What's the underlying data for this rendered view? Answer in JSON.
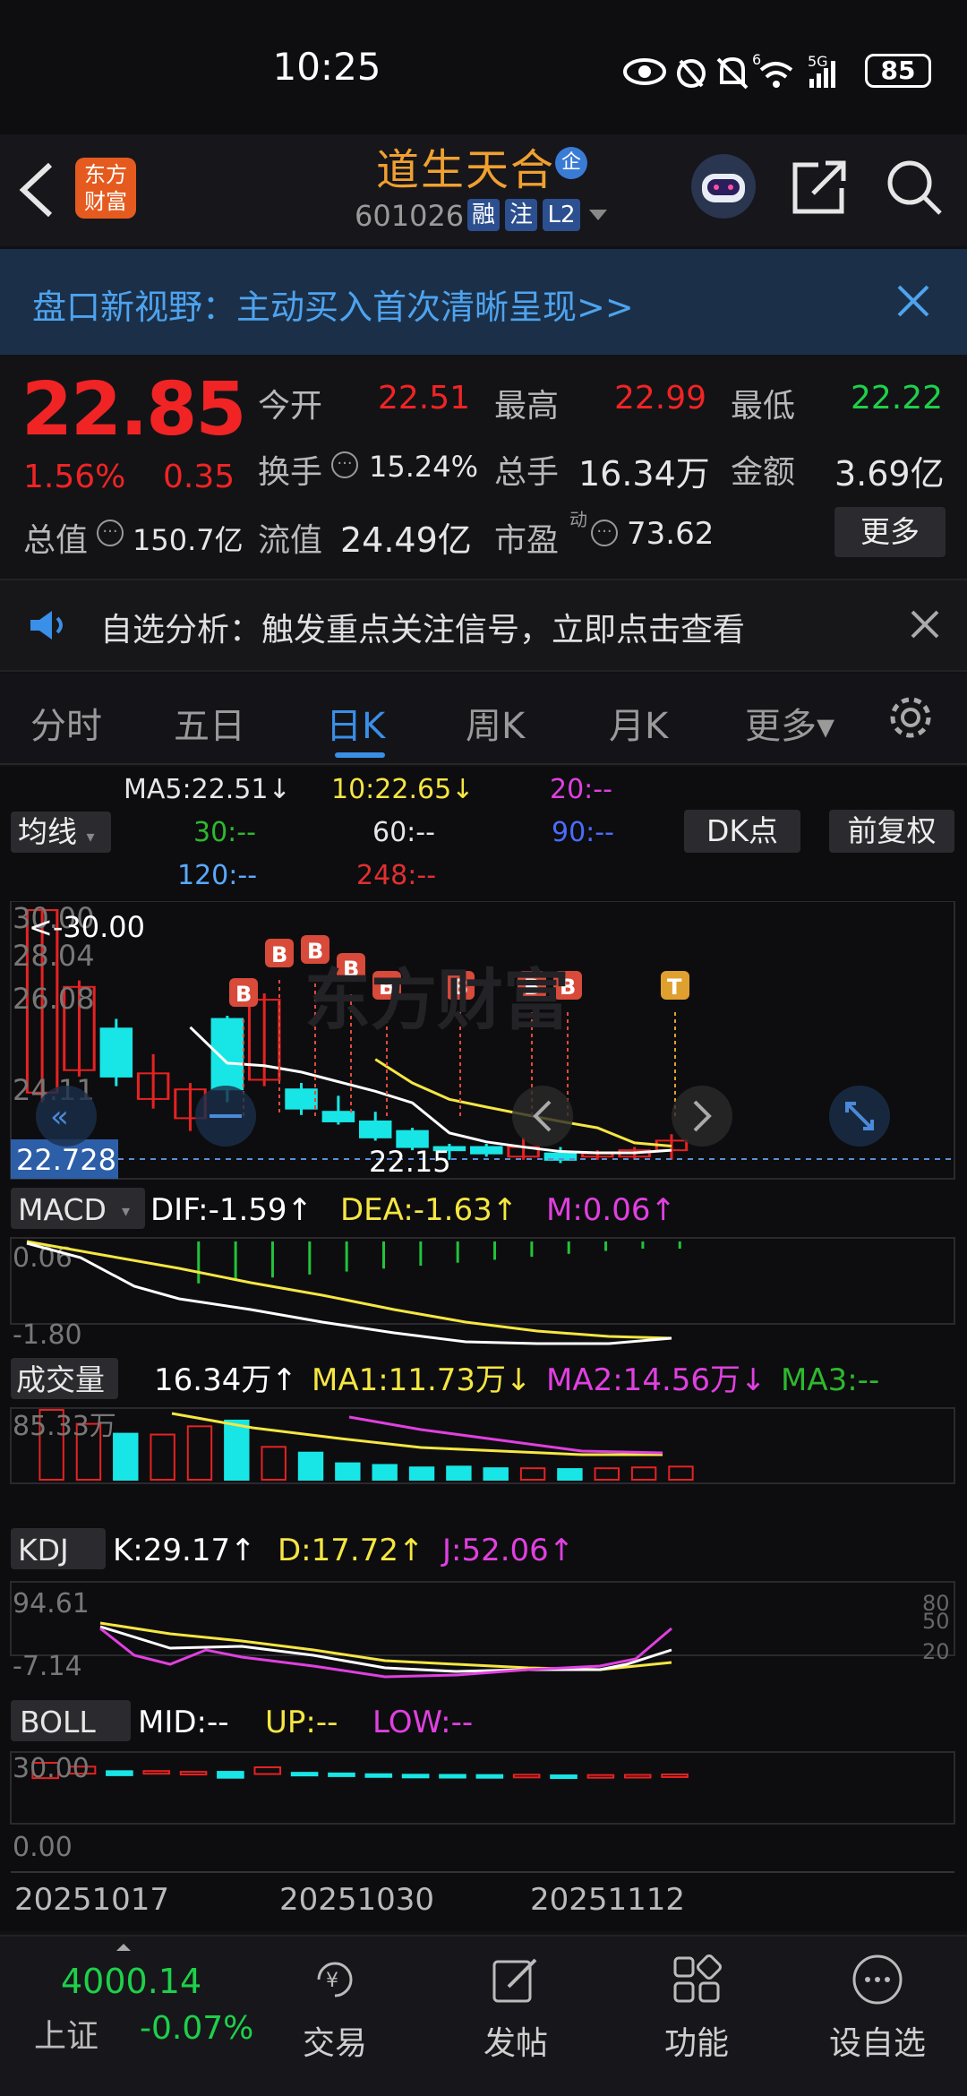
{
  "status": {
    "time": "10:25",
    "battery": "85",
    "signal_label": "5G",
    "sim_label": "6"
  },
  "header": {
    "logo_line1": "东方",
    "logo_line2": "财富",
    "name": "道生天合",
    "badge": "企",
    "code": "601026",
    "tags": [
      "融",
      "注",
      "L2"
    ],
    "icons": [
      "back-icon",
      "robot-avatar-icon",
      "share-icon",
      "search-icon"
    ]
  },
  "banner": {
    "text": "盘口新视野：主动买入首次清晰呈现>>"
  },
  "quote": {
    "price": "22.85",
    "change_pct": "1.56%",
    "change_amt": "0.35",
    "open_label": "今开",
    "open": "22.51",
    "high_label": "最高",
    "high": "22.99",
    "low_label": "最低",
    "low": "22.22",
    "turnover_label": "换手",
    "turnover": "15.24%",
    "volume_label": "总手",
    "volume": "16.34万",
    "amount_label": "金额",
    "amount": "3.69亿",
    "mcap_label": "总值",
    "mcap": "150.7亿",
    "float_label": "流值",
    "float": "24.49亿",
    "pe_label": "市盈",
    "pe_sup": "动",
    "pe": "73.62",
    "more": "更多"
  },
  "notice": {
    "text": "自选分析：触发重点关注信号，立即点击查看"
  },
  "tabs": [
    "分时",
    "五日",
    "日K",
    "周K",
    "月K",
    "更多▾"
  ],
  "active_tab": 2,
  "ma": {
    "selector": "均线",
    "ma5": "MA5:22.51↓",
    "ma10": "10:22.65↓",
    "ma20": "20:--",
    "ma30": "30:--",
    "ma60": "60:--",
    "ma90": "90:--",
    "ma120": "120:--",
    "ma248": "248:--",
    "dk_button": "DK点",
    "adjust_button": "前复权",
    "colors": {
      "ma5": "#ffffff",
      "ma10": "#f5e642",
      "ma20": "#e040e0",
      "ma30": "#2eb82e",
      "ma60": "#ffffff",
      "ma90": "#4a6cff",
      "ma120": "#5aa9ff",
      "ma248": "#e03030"
    }
  },
  "kline": {
    "y_ticks": [
      "30.00",
      "28.04",
      "26.08",
      "24.11"
    ],
    "max_label": "<-30.00",
    "current_price_label": "22.728",
    "min_label": "22.15",
    "markers": [
      "B",
      "B",
      "B",
      "B",
      "B",
      "B",
      "B",
      "B",
      "T"
    ]
  },
  "macd": {
    "selector": "MACD",
    "dif": "DIF:-1.59↑",
    "dea": "DEA:-1.63↑",
    "m": "M:0.06↑",
    "y_top": "0.06",
    "y_bottom": "-1.80"
  },
  "vol": {
    "selector": "成交量",
    "value": "16.34万↑",
    "ma1": "MA1:11.73万↓",
    "ma2": "MA2:14.56万↓",
    "ma3": "MA3:--",
    "y_top": "85.33万"
  },
  "kdj": {
    "selector": "KDJ",
    "k": "K:29.17↑",
    "d": "D:17.72↑",
    "j": "J:52.06↑",
    "y_top": "94.61",
    "y_bottom": "-7.14",
    "levels": [
      "80",
      "50",
      "20"
    ]
  },
  "boll": {
    "selector": "BOLL",
    "mid": "MID:--",
    "up": "UP:--",
    "low": "LOW:--",
    "y_top": "30.00",
    "y_bottom": "0.00"
  },
  "dates": [
    "20251017",
    "20251030",
    "20251112"
  ],
  "chart_data": {
    "type": "candlestick",
    "candles": [
      {
        "o": 24.3,
        "c": 30.0,
        "h": 30.0,
        "l": 24.0
      },
      {
        "o": 25.0,
        "c": 27.6,
        "h": 27.8,
        "l": 24.8
      },
      {
        "o": 26.3,
        "c": 24.8,
        "h": 26.6,
        "l": 24.5
      },
      {
        "o": 24.1,
        "c": 24.9,
        "h": 25.5,
        "l": 23.8
      },
      {
        "o": 23.5,
        "c": 24.4,
        "h": 24.6,
        "l": 23.1
      },
      {
        "o": 26.6,
        "c": 24.4,
        "h": 26.7,
        "l": 24.0
      },
      {
        "o": 24.7,
        "c": 27.2,
        "h": 27.4,
        "l": 24.5
      },
      {
        "o": 24.4,
        "c": 23.8,
        "h": 24.6,
        "l": 23.6
      },
      {
        "o": 23.7,
        "c": 23.4,
        "h": 24.2,
        "l": 23.3
      },
      {
        "o": 23.4,
        "c": 22.9,
        "h": 23.7,
        "l": 22.8
      },
      {
        "o": 23.1,
        "c": 22.6,
        "h": 23.2,
        "l": 22.5
      },
      {
        "o": 22.6,
        "c": 22.5,
        "h": 22.7,
        "l": 22.2
      },
      {
        "o": 22.6,
        "c": 22.4,
        "h": 22.7,
        "l": 22.3
      },
      {
        "o": 22.3,
        "c": 22.6,
        "h": 22.9,
        "l": 22.2
      },
      {
        "o": 22.4,
        "c": 22.2,
        "h": 22.6,
        "l": 22.1
      },
      {
        "o": 22.3,
        "c": 22.4,
        "h": 22.5,
        "l": 22.2
      },
      {
        "o": 22.3,
        "c": 22.5,
        "h": 22.6,
        "l": 22.2
      },
      {
        "o": 22.5,
        "c": 22.8,
        "h": 23.0,
        "l": 22.2
      }
    ],
    "volume": [
      85,
      68,
      56,
      55,
      65,
      72,
      40,
      33,
      20,
      18,
      15,
      16,
      14,
      14,
      13,
      14,
      15,
      16
    ],
    "ylim": [
      22.0,
      30.0
    ]
  },
  "nav": {
    "index_value": "4000.14",
    "index_name": "上证",
    "index_change": "-0.07%",
    "items": [
      "交易",
      "发帖",
      "功能",
      "设自选"
    ]
  }
}
